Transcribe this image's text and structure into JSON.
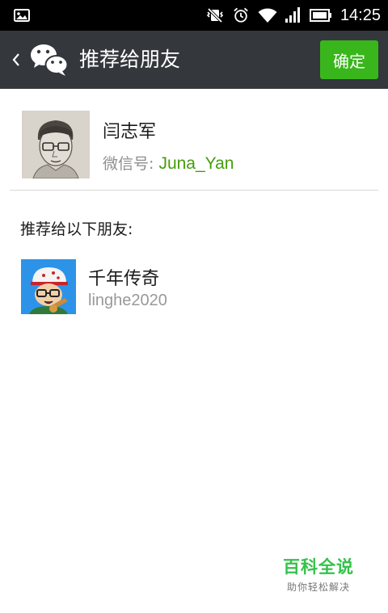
{
  "status_bar": {
    "time": "14:25",
    "icons": [
      "picture-icon",
      "mute-vibrate-icon",
      "alarm-icon",
      "wifi-icon",
      "signal-icon",
      "battery-icon"
    ]
  },
  "header": {
    "back_icon": "chevron-left-icon",
    "logo_icon": "wechat-logo-icon",
    "title": "推荐给朋友",
    "confirm_label": "确定"
  },
  "contact": {
    "name": "闫志军",
    "id_label": "微信号: ",
    "id_value": "Juna_Yan"
  },
  "section": {
    "label": "推荐给以下朋友:"
  },
  "friends": [
    {
      "name": "千年传奇",
      "id": "linghe2020"
    }
  ],
  "watermark": {
    "title": "百科全说",
    "subtitle": "助你轻松解决"
  },
  "colors": {
    "status_bar_bg": "#000000",
    "title_bar_bg": "#34373c",
    "confirm_bg": "#39b61b",
    "id_value_color": "#459d0c",
    "watermark_color": "#34c24a"
  }
}
